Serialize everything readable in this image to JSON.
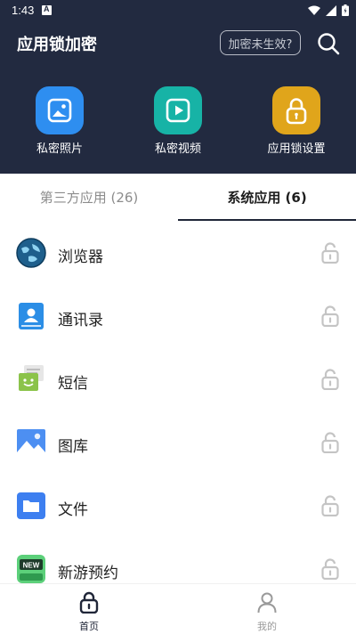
{
  "status": {
    "time": "1:43",
    "notif_letter": "A"
  },
  "header": {
    "title": "应用锁加密",
    "hint_button": "加密未生效?"
  },
  "features": [
    {
      "label": "私密照片",
      "icon": "photo-icon",
      "color": "#2e8ef0"
    },
    {
      "label": "私密视频",
      "icon": "video-play-icon",
      "color": "#17b3a6"
    },
    {
      "label": "应用锁设置",
      "icon": "lock-icon",
      "color": "#e0a51b"
    }
  ],
  "tabs": {
    "third_party": "第三方应用 (26)",
    "system": "系统应用 (6)",
    "active": "system"
  },
  "apps": [
    {
      "name": "浏览器",
      "icon": "browser-globe-icon"
    },
    {
      "name": "通讯录",
      "icon": "contacts-icon"
    },
    {
      "name": "短信",
      "icon": "messages-icon"
    },
    {
      "name": "图库",
      "icon": "gallery-icon"
    },
    {
      "name": "文件",
      "icon": "files-folder-icon"
    },
    {
      "name": "新游预约",
      "icon": "new-games-icon",
      "badge": "NEW"
    }
  ],
  "bottom_nav": {
    "home": "首页",
    "mine": "我的",
    "active": "home"
  }
}
